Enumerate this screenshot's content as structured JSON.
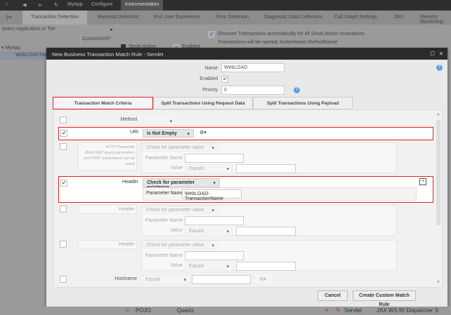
{
  "nav": {
    "breadcrumb": [
      "MyApp",
      "Configure"
    ],
    "current": "Instrumentation"
  },
  "tabs": [
    "Transaction Detection",
    "Backend Detection",
    "End User Experience",
    "Error Detection",
    "Diagnostic Data Collectors",
    "Call Graph Settings",
    "JMX",
    "Memory Monitoring"
  ],
  "sidebar": {
    "header": "Select Application or Tier",
    "col": "Customized?",
    "tree": [
      "MyApp",
      "WebLOADTier"
    ]
  },
  "struts": {
    "label": "Struts Action",
    "enabled": "Enabled",
    "discover": "Discover Transactions automatically for all Struts Action invocations",
    "naming": "Transactions will be named: ActionName.MethodName"
  },
  "modal": {
    "title": "New Business Transaction Match Rule - Servlet",
    "name_label": "Name",
    "name_value": "WebLOAD",
    "enabled_label": "Enabled",
    "enabled": true,
    "priority_label": "Priority",
    "priority_value": "0",
    "tabs": [
      "Transaction Match Criteria",
      "Split Transactions Using Request Data",
      "Split Transactions Using Payload"
    ],
    "method": {
      "label": "Method",
      "checked": false
    },
    "uri": {
      "label": "URI",
      "checked": true,
      "op": "Is Not Empty"
    },
    "http_param": {
      "label": "HTTP Parameter",
      "note": "(Both GET query parameters and POST parameters can be used)",
      "checked": false,
      "op": "Check for parameter value",
      "param_label": "Parameter Name",
      "value_label": "Value",
      "value_op": "Equals"
    },
    "header1": {
      "label": "Header",
      "checked": true,
      "op": "Check for parameter existence",
      "param_label": "Parameter Name",
      "param_value": "WebLOAD-TransactionName"
    },
    "header2": {
      "label": "Header",
      "checked": false,
      "op": "Check for parameter value",
      "param_label": "Parameter Name",
      "value_label": "Value",
      "value_op": "Equals"
    },
    "header3": {
      "label": "Header",
      "checked": false,
      "op": "Check for parameter value",
      "param_label": "Parameter Name",
      "value_label": "Value",
      "value_op": "Equals"
    },
    "hostname": {
      "label": "Hostname",
      "checked": false,
      "op": "Equals"
    },
    "cancel": "Cancel",
    "create": "Create Custom Match Rule"
  },
  "bottom": {
    "type": "POJO",
    "name": "Quartz",
    "type2": "Servlet",
    "name2": "JAX WS RI Dispatcher S"
  }
}
